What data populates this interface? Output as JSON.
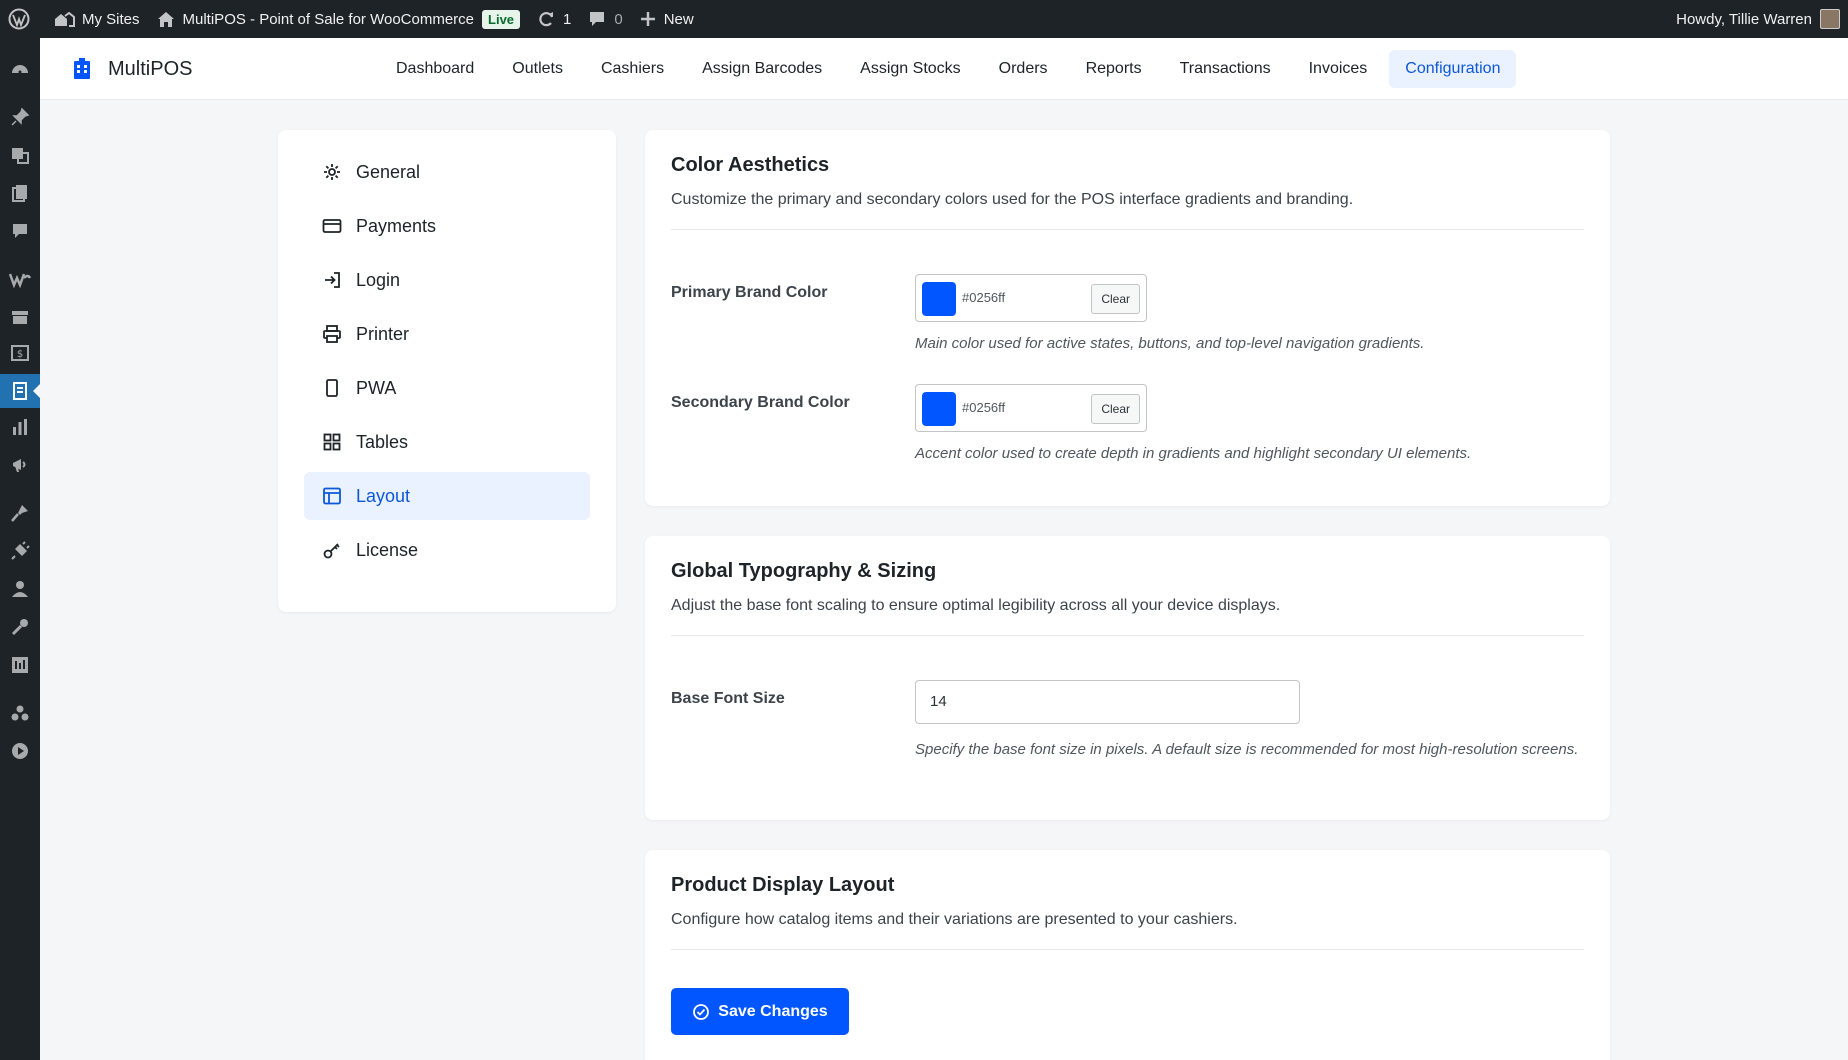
{
  "adminbar": {
    "my_sites": "My Sites",
    "site_name": "MultiPOS - Point of Sale for WooCommerce",
    "live_badge": "Live",
    "updates_count": "1",
    "comments_count": "0",
    "new_label": "New",
    "howdy": "Howdy, Tillie Warren"
  },
  "header": {
    "brand": "MultiPOS",
    "nav": [
      {
        "label": "Dashboard"
      },
      {
        "label": "Outlets"
      },
      {
        "label": "Cashiers"
      },
      {
        "label": "Assign Barcodes"
      },
      {
        "label": "Assign Stocks"
      },
      {
        "label": "Orders"
      },
      {
        "label": "Reports"
      },
      {
        "label": "Transactions"
      },
      {
        "label": "Invoices"
      },
      {
        "label": "Configuration",
        "active": true
      }
    ]
  },
  "sidebar": {
    "items": [
      {
        "label": "General",
        "icon": "gear-icon"
      },
      {
        "label": "Payments",
        "icon": "credit-card-icon"
      },
      {
        "label": "Login",
        "icon": "login-icon"
      },
      {
        "label": "Printer",
        "icon": "printer-icon"
      },
      {
        "label": "PWA",
        "icon": "phone-icon"
      },
      {
        "label": "Tables",
        "icon": "grid-icon"
      },
      {
        "label": "Layout",
        "icon": "layout-icon",
        "active": true
      },
      {
        "label": "License",
        "icon": "key-icon"
      }
    ]
  },
  "color_section": {
    "title": "Color Aesthetics",
    "description": "Customize the primary and secondary colors used for the POS interface gradients and branding.",
    "primary": {
      "label": "Primary Brand Color",
      "value": "#0256ff",
      "clear_label": "Clear",
      "hint": "Main color used for active states, buttons, and top-level navigation gradients."
    },
    "secondary": {
      "label": "Secondary Brand Color",
      "value": "#0256ff",
      "clear_label": "Clear",
      "hint": "Accent color used to create depth in gradients and highlight secondary UI elements."
    }
  },
  "typography_section": {
    "title": "Global Typography & Sizing",
    "description": "Adjust the base font scaling to ensure optimal legibility across all your device displays.",
    "base_font": {
      "label": "Base Font Size",
      "value": "14",
      "hint": "Specify the base font size in pixels. A default size is recommended for most high-resolution screens."
    }
  },
  "product_section": {
    "title": "Product Display Layout",
    "description": "Configure how catalog items and their variations are presented to your cashiers.",
    "save_label": "Save Changes"
  },
  "colors": {
    "brand": "#0256ff",
    "active_text": "#0d58d8",
    "active_bg": "#eaf1ff",
    "admin_bar": "#1d2327"
  }
}
